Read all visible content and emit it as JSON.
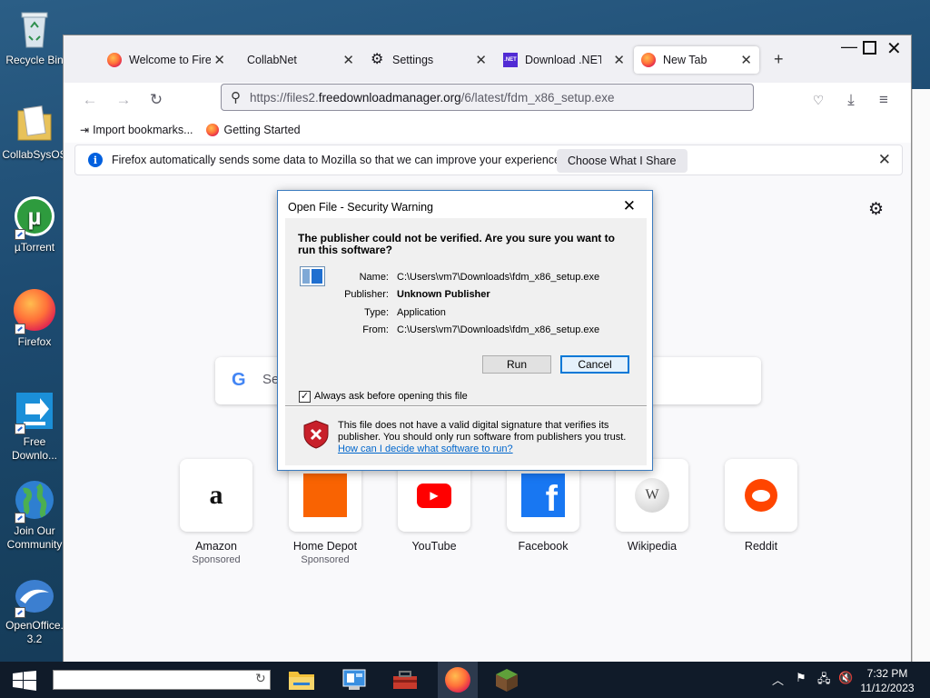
{
  "desktop": {
    "icons": [
      {
        "label": "Recycle Bin",
        "icon": "recycle-bin-icon"
      },
      {
        "label": "CollabSysOS",
        "icon": "folder-icon"
      },
      {
        "label": "µTorrent",
        "icon": "utorrent-icon"
      },
      {
        "label": "Firefox",
        "icon": "firefox-icon"
      },
      {
        "label": "Free Downlo...",
        "icon": "free-download-manager-icon"
      },
      {
        "label": "Join Our Community",
        "icon": "globe-icon"
      },
      {
        "label": "OpenOffice. 3.2",
        "icon": "openoffice-icon"
      }
    ]
  },
  "browser": {
    "tabs": [
      {
        "label": "Welcome to Fire",
        "icon": "firefox-icon"
      },
      {
        "label": "CollabNet",
        "icon": ""
      },
      {
        "label": "Settings",
        "icon": "gear-icon"
      },
      {
        "label": "Download .NET",
        "icon": "dotnet-icon"
      },
      {
        "label": "New Tab",
        "icon": "firefox-icon"
      }
    ],
    "url": {
      "prefix": "https://files2.",
      "domain": "freedownloadmanager.org",
      "path": "/6/latest/fdm_x86_setup.exe"
    },
    "bookmarks": [
      {
        "label": "Import bookmarks...",
        "icon": "import-icon"
      },
      {
        "label": "Getting Started",
        "icon": "firefox-icon"
      }
    ],
    "infobar": {
      "message": "Firefox automatically sends some data to Mozilla so that we can improve your experience.",
      "button": "Choose What I Share"
    },
    "search_placeholder": "Se",
    "top_sites": [
      {
        "name": "Amazon",
        "sub": "Sponsored",
        "icon": "amazon-icon"
      },
      {
        "name": "Home Depot",
        "sub": "Sponsored",
        "icon": "home-depot-icon"
      },
      {
        "name": "YouTube",
        "sub": "",
        "icon": "youtube-icon"
      },
      {
        "name": "Facebook",
        "sub": "",
        "icon": "facebook-icon"
      },
      {
        "name": "Wikipedia",
        "sub": "",
        "icon": "wikipedia-icon"
      },
      {
        "name": "Reddit",
        "sub": "",
        "icon": "reddit-icon"
      }
    ]
  },
  "dialog": {
    "title": "Open File - Security Warning",
    "heading": "The publisher could not be verified.  Are you sure you want to run this software?",
    "fields": [
      {
        "label": "Name:",
        "value": "C:\\Users\\vm7\\Downloads\\fdm_x86_setup.exe"
      },
      {
        "label": "Publisher:",
        "value": "Unknown Publisher"
      },
      {
        "label": "Type:",
        "value": "Application"
      },
      {
        "label": "From:",
        "value": "C:\\Users\\vm7\\Downloads\\fdm_x86_setup.exe"
      }
    ],
    "run_label": "Run",
    "cancel_label": "Cancel",
    "checkbox_label": "Always ask before opening this file",
    "checkbox_checked": true,
    "footer_text": "This file does not have a valid digital signature that verifies its publisher.  You should only run software from publishers you trust.",
    "footer_link": "How can I decide what software to run?"
  },
  "taskbar": {
    "time": "7:32 PM",
    "date": "11/12/2023"
  }
}
